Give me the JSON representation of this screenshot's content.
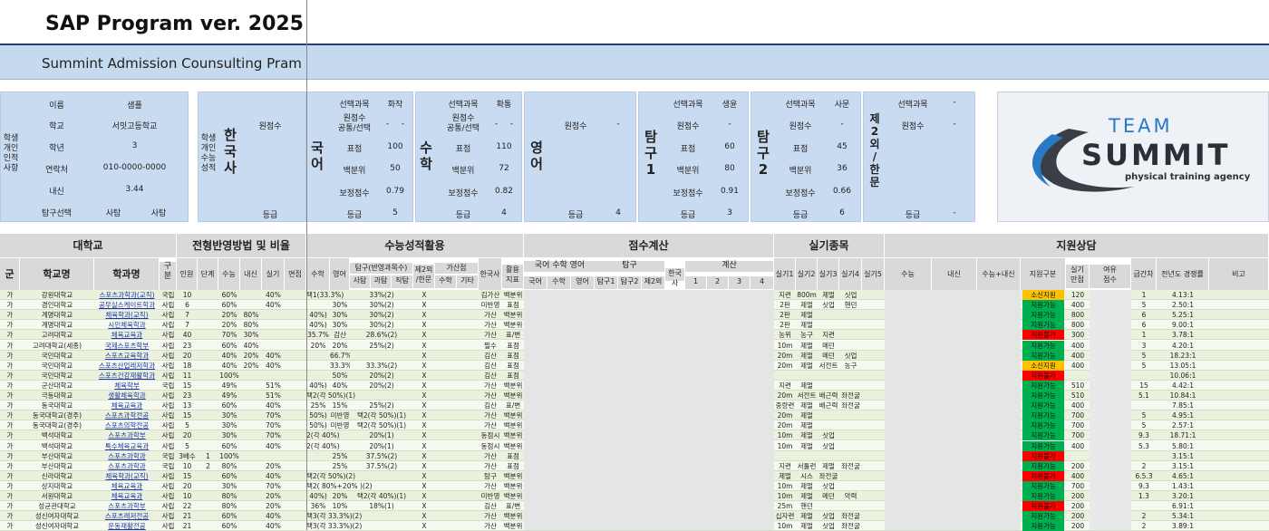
{
  "header": {
    "title": "SAP Program ver. 2025",
    "subtitle": "Summint Admission Counsulting Pram"
  },
  "student": {
    "section_label": "학생\n개인\n인적\n사항",
    "name_label": "이름",
    "name": "샘플",
    "school_label": "학교",
    "school": "서밋고등학교",
    "grade_label": "학년",
    "grade": "3",
    "contact_label": "연락처",
    "contact": "010-0000-0000",
    "gpa_label": "내신",
    "gpa": "3.44",
    "inquiry_label": "탐구선택",
    "inquiry1": "사탐",
    "inquiry2": "사탐"
  },
  "scores_panel": {
    "section_label": "학생\n개인\n수능\n성적",
    "history": "한\n국\n사",
    "history_raw_label": "원점수",
    "history_grade_label": "등급",
    "korean": {
      "name": "국\n어",
      "subject_label": "선택과목",
      "subject": "화작",
      "raw_label": "원점수\n공통/선택",
      "raw": "-",
      "raw2": "-",
      "std_label": "표점",
      "std": "100",
      "pct_label": "백분위",
      "pct": "50",
      "adj_label": "보정점수",
      "adj": "0.79",
      "grade_label": "등급",
      "grade": "5"
    },
    "math": {
      "name": "수\n학",
      "subject_label": "선택과목",
      "subject": "확통",
      "raw_label": "원점수\n공통/선택",
      "raw": "-",
      "raw2": "-",
      "std_label": "표점",
      "std": "110",
      "pct_label": "백분위",
      "pct": "72",
      "adj_label": "보정점수",
      "adj": "0.82",
      "grade_label": "등급",
      "grade": "4"
    },
    "english": {
      "name": "영\n어",
      "raw_label": "원점수",
      "raw": "-",
      "grade_label": "등급",
      "grade": "4"
    },
    "inquiry1": {
      "name": "탐\n구\n1",
      "subject_label": "선택과목",
      "subject": "생윤",
      "raw_label": "원점수",
      "raw": "-",
      "std_label": "표점",
      "std": "60",
      "pct_label": "백분위",
      "pct": "80",
      "adj_label": "보정점수",
      "adj": "0.91",
      "grade_label": "등급",
      "grade": "3"
    },
    "inquiry2": {
      "name": "탐\n구\n2",
      "subject_label": "선택과목",
      "subject": "사문",
      "raw_label": "원점수",
      "raw": "-",
      "std_label": "표점",
      "std": "45",
      "pct_label": "백분위",
      "pct": "36",
      "adj_label": "보정점수",
      "adj": "0.66",
      "grade_label": "등급",
      "grade": "6"
    },
    "second_lang": {
      "name": "제\n2\n외\n/\n한\n문",
      "subject_label": "선택과목",
      "subject": "-",
      "raw_label": "원점수",
      "raw": "-",
      "grade_label": "등급",
      "grade": "-"
    }
  },
  "logo": {
    "line1": "TEAM",
    "line2": "SUMMIT",
    "tagline": "physical training agency"
  },
  "table_headers": {
    "univ": "대학교",
    "method": "전형반영방법 및 비율",
    "suneung": "수능성적활용",
    "calc": "점수계산",
    "practical": "실기종목",
    "consult": "지원상담",
    "gun": "군",
    "school_name": "학교명",
    "dept": "학과명",
    "gubun": "구\n분",
    "quota": "인원",
    "stage": "단계",
    "sn": "수능",
    "nae": "내신",
    "sil": "실기",
    "myeon": "면접",
    "s_math": "수학",
    "s_eng": "영어",
    "s_inq": "탐구(반영과목수)",
    "s_inq_sa": "사탐",
    "s_inq_gwa": "과탐",
    "s_inq_jik": "직탐",
    "s_2nd": "제2외\n/한문",
    "s_bonus": "가산점",
    "s_bonus_math": "수학",
    "s_bonus_etc": "기타",
    "s_hist": "한국사",
    "s_use": "활용\n지표",
    "c_kme": "국어 수학 영어",
    "c_k": "국어",
    "c_m": "수학",
    "c_e": "영어",
    "c_inq": "탐구",
    "c_inq1": "탐구1",
    "c_inq2": "탐구2",
    "c_2nd": "제2외",
    "c_hist": "한국사",
    "c_calc": "계산",
    "c_1": "1",
    "c_2": "2",
    "c_3": "3",
    "c_4": "4",
    "p1": "실기1",
    "p2": "실기2",
    "p3": "실기3",
    "p4": "실기4",
    "p5": "실기5",
    "k_sn": "수능",
    "k_nae": "내신",
    "k_sum": "수능+내신",
    "k_type": "지원구분",
    "k_full": "실기\n만점",
    "k_margin": "여유\n점수",
    "k_gap": "급간차",
    "k_comp": "전년도 경쟁률",
    "k_note": "비고"
  },
  "status_colors": {
    "안정": "#00b050",
    "소신": "#ffc000",
    "위험": "#ff0000"
  },
  "rows": [
    {
      "gun": "가",
      "school": "강원대학교",
      "dept": "스포츠과학과(교직)",
      "gb": "국립",
      "q": "10",
      "st": "",
      "sn": "60%",
      "nae": "",
      "sil": "40%",
      "my": "",
      "sm": "택1(33.3%)",
      "se": "",
      "si": "33%(2)",
      "s2": "X",
      "bh": "김가산",
      "use": "백분위",
      "p1": "지련",
      "p2": "800m",
      "p3": "제멀",
      "p4": "싯업",
      "p5": "",
      "type": "소신지원",
      "tc": "#ffc000",
      "full": "120",
      "gap": "1",
      "comp": "4.13:1"
    },
    {
      "gun": "가",
      "school": "경인대학교",
      "dept": "공무실스케이트학과",
      "gb": "사립",
      "q": "6",
      "st": "",
      "sn": "60%",
      "nae": "",
      "sil": "40%",
      "my": "",
      "sm": "",
      "se": "30%",
      "si": "30%(2)",
      "s2": "X",
      "bh": "미반영",
      "use": "표점",
      "p1": "2판",
      "p2": "제멀",
      "p3": "싯업",
      "p4": "핸던",
      "p5": "",
      "type": "지원가능",
      "tc": "#00b050",
      "full": "400",
      "gap": "5",
      "comp": "2.50:1"
    },
    {
      "gun": "가",
      "school": "계명대학교",
      "dept": "체육학과(교직)",
      "gb": "사립",
      "q": "7",
      "st": "",
      "sn": "20%",
      "nae": "80%",
      "sil": "",
      "my": "",
      "sm": "40%)",
      "se": "30%",
      "si": "30%(2)",
      "s2": "X",
      "bh": "가산",
      "use": "백분위",
      "p1": "2판",
      "p2": "제멀",
      "p3": "",
      "p4": "",
      "p5": "",
      "type": "지원가능",
      "tc": "#00b050",
      "full": "800",
      "gap": "6",
      "comp": "5.25:1"
    },
    {
      "gun": "가",
      "school": "계명대학교",
      "dept": "시민체육학과",
      "gb": "사립",
      "q": "7",
      "st": "",
      "sn": "20%",
      "nae": "80%",
      "sil": "",
      "my": "",
      "sm": "40%)",
      "se": "30%",
      "si": "30%(2)",
      "s2": "X",
      "bh": "가산",
      "use": "백분위",
      "p1": "2판",
      "p2": "제멀",
      "p3": "",
      "p4": "",
      "p5": "",
      "type": "지원가능",
      "tc": "#00b050",
      "full": "800",
      "gap": "6",
      "comp": "9.00:1"
    },
    {
      "gun": "가",
      "school": "고려대학교",
      "dept": "체육교육과",
      "gb": "사립",
      "q": "40",
      "st": "",
      "sn": "70%",
      "nae": "30%",
      "sil": "",
      "my": "",
      "sm": "35.7%",
      "se": "감산",
      "si": "28.6%(2)",
      "s2": "X",
      "bh": "가산",
      "use": "표/변",
      "p1": "농위",
      "p2": "농구",
      "p3": "지련",
      "p4": "",
      "p5": "",
      "type": "지원불가",
      "tc": "#ff0000",
      "full": "300",
      "gap": "1",
      "comp": "3.78:1"
    },
    {
      "gun": "가",
      "school": "고려대학교(세종)",
      "dept": "국제스포츠학부",
      "gb": "사립",
      "q": "23",
      "st": "",
      "sn": "60%",
      "nae": "40%",
      "sil": "",
      "my": "",
      "sm": "20%",
      "se": "20%",
      "si": "25%(2)",
      "s2": "X",
      "bh": "필수",
      "use": "표점",
      "p1": "10m",
      "p2": "제멀",
      "p3": "메던",
      "p4": "",
      "p5": "",
      "type": "지원가능",
      "tc": "#00b050",
      "full": "400",
      "gap": "3",
      "comp": "4.20:1"
    },
    {
      "gun": "가",
      "school": "국민대학교",
      "dept": "스포츠교육학과",
      "gb": "사립",
      "q": "20",
      "st": "",
      "sn": "40%",
      "nae": "20%",
      "sil": "40%",
      "my": "",
      "sm": "",
      "se": "66.7%",
      "si": "",
      "s2": "X",
      "bh": "김산",
      "use": "표점",
      "p1": "20m",
      "p2": "제멀",
      "p3": "메던",
      "p4": "싯업",
      "p5": "",
      "type": "지원가능",
      "tc": "#00b050",
      "full": "400",
      "gap": "5",
      "comp": "18.23:1"
    },
    {
      "gun": "가",
      "school": "국민대학교",
      "dept": "스포츠산업레저학과",
      "gb": "사립",
      "q": "18",
      "st": "",
      "sn": "40%",
      "nae": "20%",
      "sil": "40%",
      "my": "",
      "sm": "",
      "se": "33.3%",
      "si": "33.3%(2)",
      "s2": "X",
      "bh": "김산",
      "use": "표점",
      "p1": "20m",
      "p2": "제멀",
      "p3": "서전트",
      "p4": "농구",
      "p5": "",
      "type": "소신지원",
      "tc": "#ffc000",
      "full": "400",
      "gap": "5",
      "comp": "13.05:1"
    },
    {
      "gun": "가",
      "school": "국민대학교",
      "dept": "스포츠건강재활학과",
      "gb": "사립",
      "q": "11",
      "st": "",
      "sn": "100%",
      "nae": "",
      "sil": "",
      "my": "",
      "sm": "",
      "se": "50%",
      "si": "20%(2)",
      "s2": "X",
      "bh": "김산",
      "use": "표점",
      "p1": "",
      "p2": "",
      "p3": "",
      "p4": "",
      "p5": "",
      "type": "지원불가",
      "tc": "#ff0000",
      "full": "",
      "gap": "",
      "comp": "10.06:1"
    },
    {
      "gun": "가",
      "school": "군산대학교",
      "dept": "체육학부",
      "gb": "국립",
      "q": "15",
      "st": "",
      "sn": "49%",
      "nae": "",
      "sil": "51%",
      "my": "",
      "sm": "40%)",
      "se": "40%",
      "si": "20%(2)",
      "s2": "X",
      "bh": "가산",
      "use": "백분위",
      "p1": "지련",
      "p2": "제멀",
      "p3": "",
      "p4": "",
      "p5": "",
      "type": "지원가능",
      "tc": "#00b050",
      "full": "510",
      "gap": "15",
      "comp": "4.42:1"
    },
    {
      "gun": "가",
      "school": "극동대학교",
      "dept": "생활체육학과",
      "gb": "사립",
      "q": "23",
      "st": "",
      "sn": "49%",
      "nae": "",
      "sil": "51%",
      "my": "",
      "sm": "택2(각 50%)(1)",
      "se": "",
      "si": "",
      "s2": "X",
      "bh": "가산",
      "use": "백분위",
      "p1": "20m",
      "p2": "서전트",
      "p3": "배근력",
      "p4": "좌전굴",
      "p5": "",
      "type": "지원가능",
      "tc": "#00b050",
      "full": "510",
      "gap": "5.1",
      "comp": "10.84:1"
    },
    {
      "gun": "가",
      "school": "동국대학교",
      "dept": "체육교육과",
      "gb": "사립",
      "q": "13",
      "st": "",
      "sn": "60%",
      "nae": "",
      "sil": "40%",
      "my": "",
      "sm": "25%",
      "se": "15%",
      "si": "25%(2)",
      "s2": "X",
      "bh": "김산",
      "use": "표/변",
      "p1": "중량련",
      "p2": "제멀",
      "p3": "배근력",
      "p4": "좌전굴",
      "p5": "",
      "type": "지원가능",
      "tc": "#00b050",
      "full": "400",
      "gap": "",
      "comp": "7.85:1"
    },
    {
      "gun": "가",
      "school": "동국대학교(경주)",
      "dept": "스포츠과학전공",
      "gb": "사립",
      "q": "15",
      "st": "",
      "sn": "30%",
      "nae": "",
      "sil": "70%",
      "my": "",
      "sm": "50%)",
      "se": "미반영",
      "si": "택2(각 50%)(1)",
      "s2": "X",
      "bh": "가산",
      "use": "백분위",
      "p1": "20m",
      "p2": "제멀",
      "p3": "",
      "p4": "",
      "p5": "",
      "type": "지원가능",
      "tc": "#00b050",
      "full": "700",
      "gap": "5",
      "comp": "4.95:1"
    },
    {
      "gun": "가",
      "school": "동국대학교(경주)",
      "dept": "스포츠의학전공",
      "gb": "사립",
      "q": "5",
      "st": "",
      "sn": "30%",
      "nae": "",
      "sil": "70%",
      "my": "",
      "sm": "50%)",
      "se": "미반영",
      "si": "택2(각 50%)(1)",
      "s2": "X",
      "bh": "가산",
      "use": "백분위",
      "p1": "20m",
      "p2": "제멀",
      "p3": "",
      "p4": "",
      "p5": "",
      "type": "지원가능",
      "tc": "#00b050",
      "full": "700",
      "gap": "5",
      "comp": "2.57:1"
    },
    {
      "gun": "가",
      "school": "백석대학교",
      "dept": "스포츠과학부",
      "gb": "사립",
      "q": "20",
      "st": "",
      "sn": "30%",
      "nae": "",
      "sil": "70%",
      "my": "",
      "sm": "2(각 40%)",
      "se": "",
      "si": "20%(1)",
      "s2": "X",
      "bh": "동점시",
      "use": "백분위",
      "p1": "10m",
      "p2": "제멀",
      "p3": "싯업",
      "p4": "",
      "p5": "",
      "type": "지원가능",
      "tc": "#00b050",
      "full": "700",
      "gap": "9.3",
      "comp": "18.71:1"
    },
    {
      "gun": "가",
      "school": "백석대학교",
      "dept": "특수체육교육과",
      "gb": "사립",
      "q": "5",
      "st": "",
      "sn": "60%",
      "nae": "",
      "sil": "40%",
      "my": "",
      "sm": "2(각 40%)",
      "se": "",
      "si": "20%(1)",
      "s2": "X",
      "bh": "동점시",
      "use": "백분위",
      "p1": "10m",
      "p2": "제멀",
      "p3": "싯업",
      "p4": "",
      "p5": "",
      "type": "지원가능",
      "tc": "#00b050",
      "full": "400",
      "gap": "5.3",
      "comp": "5.80:1"
    },
    {
      "gun": "가",
      "school": "부산대학교",
      "dept": "스포츠과학과",
      "gb": "국립",
      "q": "3배수",
      "st": "1",
      "sn": "100%",
      "nae": "",
      "sil": "",
      "my": "",
      "sm": "",
      "se": "25%",
      "si": "37.5%(2)",
      "s2": "X",
      "bh": "가산",
      "use": "표점",
      "p1": "",
      "p2": "",
      "p3": "",
      "p4": "",
      "p5": "",
      "type": "지원불가",
      "tc": "#ff0000",
      "full": "",
      "gap": "",
      "comp": "3.15:1"
    },
    {
      "gun": "가",
      "school": "부산대학교",
      "dept": "스포츠과학과",
      "gb": "국립",
      "q": "10",
      "st": "2",
      "sn": "80%",
      "nae": "",
      "sil": "20%",
      "my": "",
      "sm": "",
      "se": "25%",
      "si": "37.5%(2)",
      "s2": "X",
      "bh": "가산",
      "use": "표점",
      "p1": "지련",
      "p2": "서툴런",
      "p3": "제멀",
      "p4": "좌전굴",
      "p5": "",
      "type": "지원가능",
      "tc": "#00b050",
      "full": "200",
      "gap": "2",
      "comp": "3.15:1"
    },
    {
      "gun": "가",
      "school": "신라대학교",
      "dept": "체육학과(교직)",
      "gb": "사립",
      "q": "15",
      "st": "",
      "sn": "60%",
      "nae": "",
      "sil": "40%",
      "my": "",
      "sm": "택2(각 50%)(2)",
      "se": "",
      "si": "",
      "s2": "X",
      "bh": "탐구",
      "use": "백분위",
      "p1": "제멀",
      "p2": "시스",
      "p3": "좌전굴",
      "p4": "",
      "p5": "",
      "type": "지원불가",
      "tc": "#ff0000",
      "full": "400",
      "gap": "6.5.3",
      "comp": "4.65:1"
    },
    {
      "gun": "가",
      "school": "상지대학교",
      "dept": "체육교육과",
      "gb": "사립",
      "q": "20",
      "st": "",
      "sn": "30%",
      "nae": "",
      "sil": "70%",
      "my": "",
      "sm": "택2( 80%+20% )(2)",
      "se": "",
      "si": "",
      "s2": "X",
      "bh": "가산",
      "use": "백분위",
      "p1": "10m",
      "p2": "제멀",
      "p3": "싯업",
      "p4": "",
      "p5": "",
      "type": "지원가능",
      "tc": "#00b050",
      "full": "700",
      "gap": "9.3",
      "comp": "1.43:1"
    },
    {
      "gun": "가",
      "school": "서원대학교",
      "dept": "체육교육과",
      "gb": "사립",
      "q": "10",
      "st": "",
      "sn": "80%",
      "nae": "",
      "sil": "20%",
      "my": "",
      "sm": "40%)",
      "se": "20%",
      "si": "택2(각 40%)(1)",
      "s2": "X",
      "bh": "미반영",
      "use": "백분위",
      "p1": "10m",
      "p2": "제멀",
      "p3": "메던",
      "p4": "악력",
      "p5": "",
      "type": "지원가능",
      "tc": "#00b050",
      "full": "200",
      "gap": "1.3",
      "comp": "3.20:1"
    },
    {
      "gun": "가",
      "school": "성균관대학교",
      "dept": "스포츠과학부",
      "gb": "사립",
      "q": "22",
      "st": "",
      "sn": "80%",
      "nae": "",
      "sil": "20%",
      "my": "",
      "sm": "36%",
      "se": "10%",
      "si": "18%(1)",
      "s2": "X",
      "bh": "김산",
      "use": "표/변",
      "p1": "25m",
      "p2": "핸던",
      "p3": "",
      "p4": "",
      "p5": "",
      "type": "지원불가",
      "tc": "#ff0000",
      "full": "200",
      "gap": "",
      "comp": "6.91:1"
    },
    {
      "gun": "가",
      "school": "성신여자대학교",
      "dept": "스포츠레저전공",
      "gb": "사립",
      "q": "21",
      "st": "",
      "sn": "60%",
      "nae": "",
      "sil": "40%",
      "my": "",
      "sm": "택3(각 33.3%)(2)",
      "se": "",
      "si": "",
      "s2": "X",
      "bh": "가산",
      "use": "백분위",
      "p1": "십자련",
      "p2": "제멀",
      "p3": "싯업",
      "p4": "좌전굴",
      "p5": "",
      "type": "지원가능",
      "tc": "#00b050",
      "full": "200",
      "gap": "2",
      "comp": "5.34:1"
    },
    {
      "gun": "가",
      "school": "성신여자대학교",
      "dept": "운동재활전공",
      "gb": "사립",
      "q": "21",
      "st": "",
      "sn": "60%",
      "nae": "",
      "sil": "40%",
      "my": "",
      "sm": "택3(각 33.3%)(2)",
      "se": "",
      "si": "",
      "s2": "X",
      "bh": "가산",
      "use": "백분위",
      "p1": "10m",
      "p2": "제멀",
      "p3": "싯업",
      "p4": "좌전굴",
      "p5": "",
      "type": "지원가능",
      "tc": "#00b050",
      "full": "200",
      "gap": "2",
      "comp": "3.89:1"
    }
  ]
}
